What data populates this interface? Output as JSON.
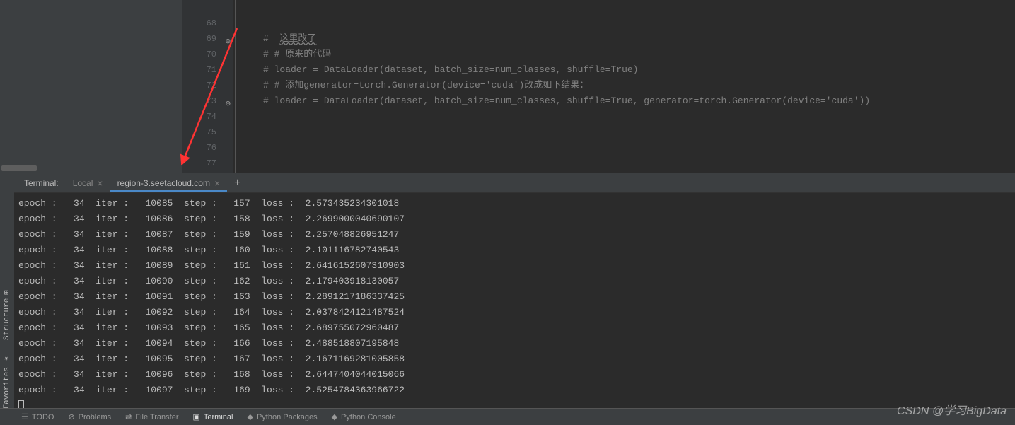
{
  "editor": {
    "lines": [
      {
        "num": "",
        "text": ""
      },
      {
        "num": "68",
        "text": ""
      },
      {
        "num": "69",
        "text": "#  这里改了",
        "underline": true,
        "foldicon": true
      },
      {
        "num": "70",
        "text": "# # 原来的代码"
      },
      {
        "num": "71",
        "text": "# loader = DataLoader(dataset, batch_size=num_classes, shuffle=True)"
      },
      {
        "num": "72",
        "text": "# # 添加generator=torch.Generator(device='cuda')改成如下结果："
      },
      {
        "num": "73",
        "text": "# loader = DataLoader(dataset, batch_size=num_classes, shuffle=True, generator=torch.Generator(device='cuda'))",
        "foldicon": true
      },
      {
        "num": "74",
        "text": ""
      },
      {
        "num": "75",
        "text": ""
      },
      {
        "num": "76",
        "text": ""
      },
      {
        "num": "77",
        "text": ""
      }
    ]
  },
  "terminal": {
    "label": "Terminal:",
    "tabs": [
      {
        "label": "Local",
        "active": false
      },
      {
        "label": "region-3.seetacloud.com",
        "active": true
      }
    ],
    "add": "+",
    "rows": [
      {
        "epoch": 34,
        "iter": 10085,
        "step": 157,
        "loss": "2.573435234301018"
      },
      {
        "epoch": 34,
        "iter": 10086,
        "step": 158,
        "loss": "2.2699000040690107"
      },
      {
        "epoch": 34,
        "iter": 10087,
        "step": 159,
        "loss": "2.257048826951247"
      },
      {
        "epoch": 34,
        "iter": 10088,
        "step": 160,
        "loss": "2.101116782740543"
      },
      {
        "epoch": 34,
        "iter": 10089,
        "step": 161,
        "loss": "2.6416152607310903"
      },
      {
        "epoch": 34,
        "iter": 10090,
        "step": 162,
        "loss": "2.179403918130057"
      },
      {
        "epoch": 34,
        "iter": 10091,
        "step": 163,
        "loss": "2.2891217186337425"
      },
      {
        "epoch": 34,
        "iter": 10092,
        "step": 164,
        "loss": "2.0378424121487524"
      },
      {
        "epoch": 34,
        "iter": 10093,
        "step": 165,
        "loss": "2.689755072960487"
      },
      {
        "epoch": 34,
        "iter": 10094,
        "step": 166,
        "loss": "2.488518807195848"
      },
      {
        "epoch": 34,
        "iter": 10095,
        "step": 167,
        "loss": "2.1671169281005858"
      },
      {
        "epoch": 34,
        "iter": 10096,
        "step": 168,
        "loss": "2.6447404044015066"
      },
      {
        "epoch": 34,
        "iter": 10097,
        "step": 169,
        "loss": "2.5254784363966722"
      }
    ]
  },
  "side_tabs": [
    {
      "label": "Structure",
      "icon": "structure-icon"
    },
    {
      "label": "Favorites",
      "icon": "star-icon"
    }
  ],
  "bottom": {
    "items": [
      {
        "label": "TODO",
        "icon": "☰"
      },
      {
        "label": "Problems",
        "icon": "⊘"
      },
      {
        "label": "File Transfer",
        "icon": "⇄"
      },
      {
        "label": "Terminal",
        "icon": "▣",
        "active": true
      },
      {
        "label": "Python Packages",
        "icon": "◆"
      },
      {
        "label": "Python Console",
        "icon": "◆"
      }
    ]
  },
  "watermark": "CSDN @学习BigData"
}
